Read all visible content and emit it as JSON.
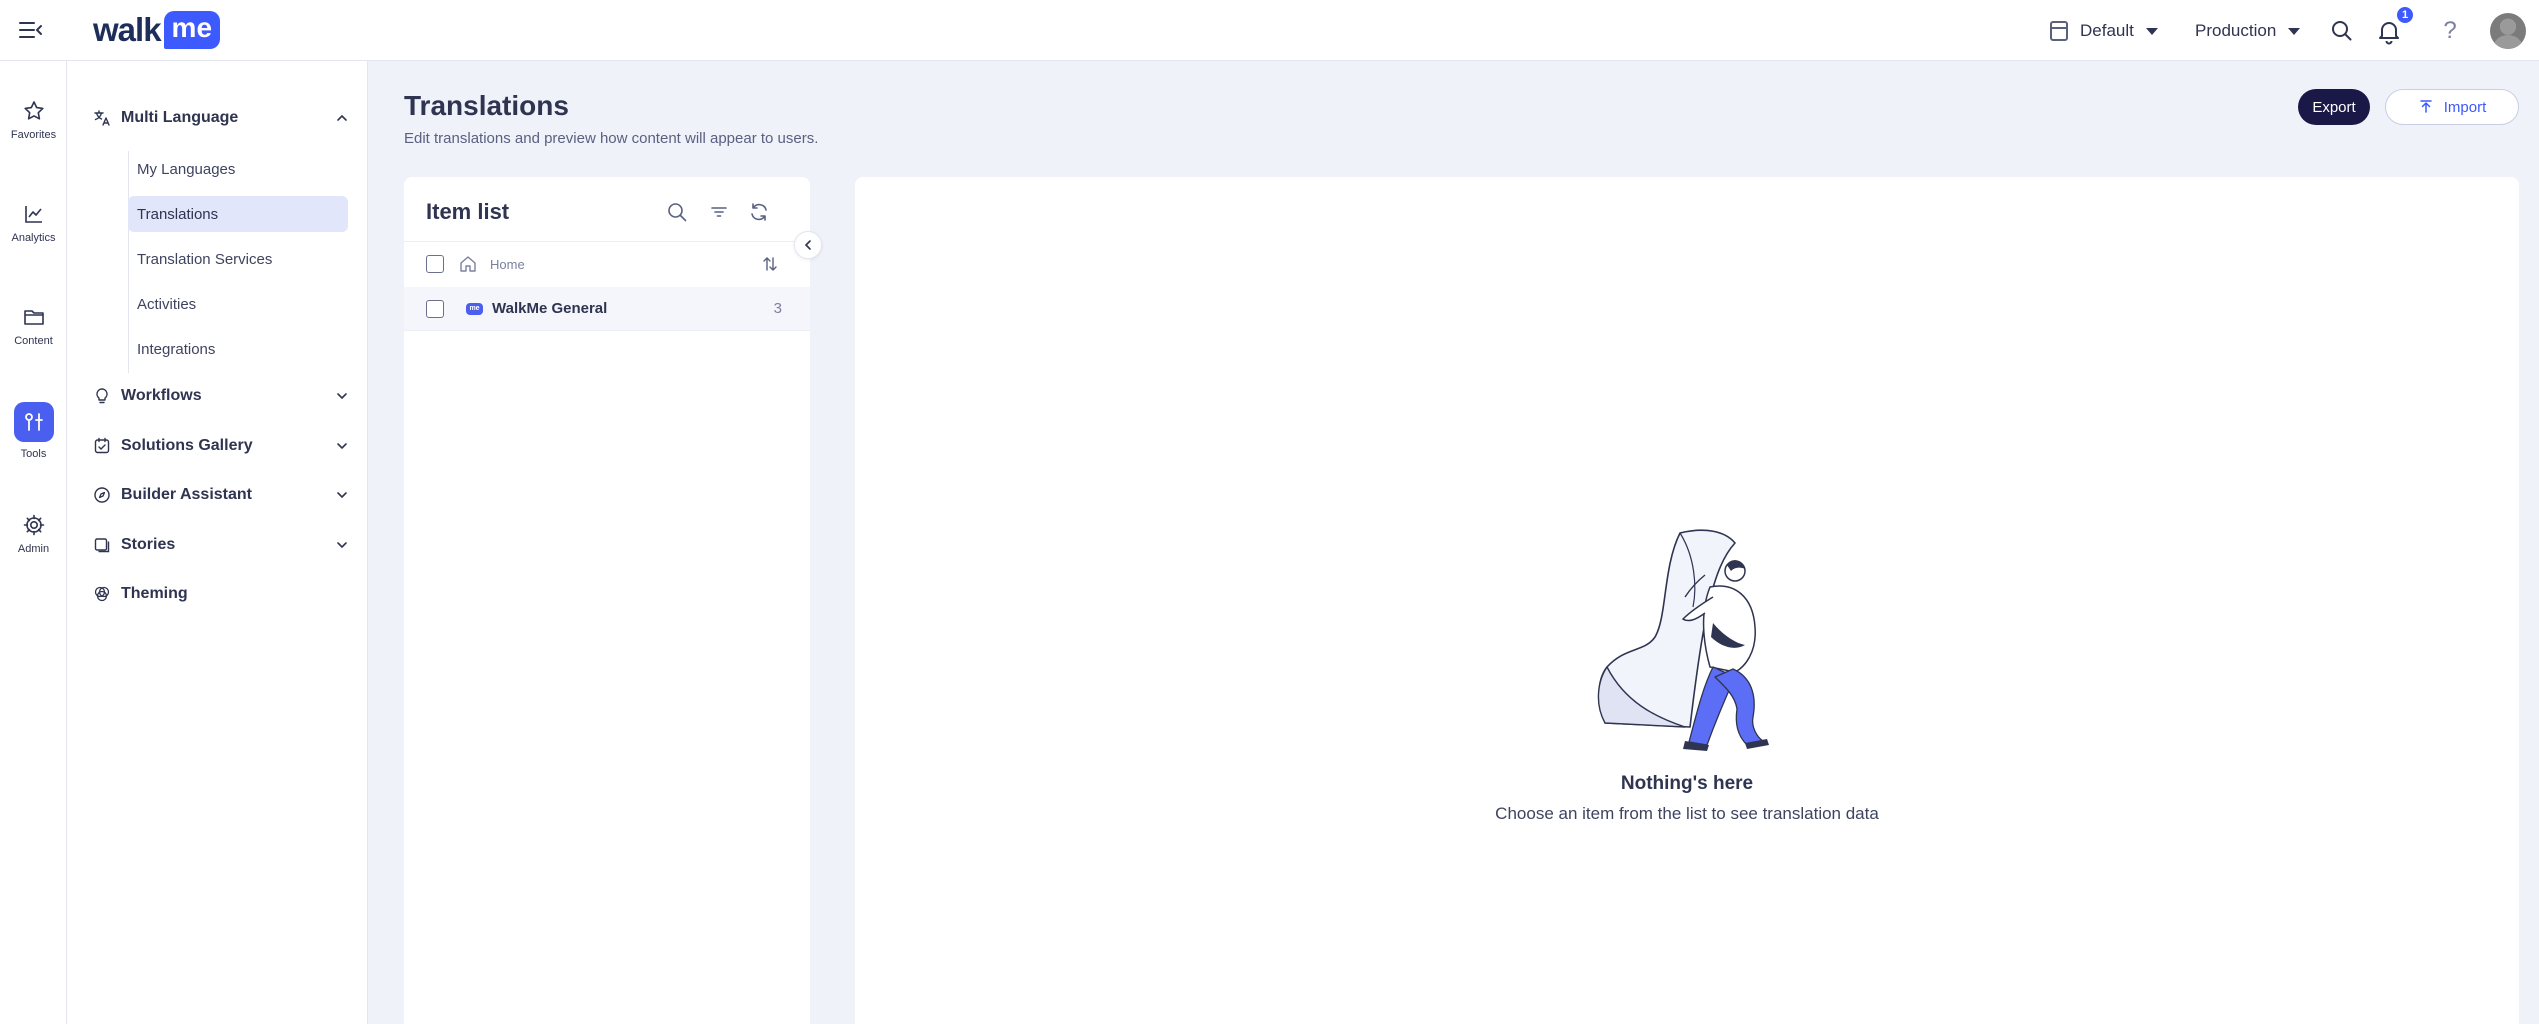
{
  "topbar": {
    "logo_walk": "walk",
    "logo_me": "me",
    "env_default": "Default",
    "env_production": "Production",
    "notifications_count": "1",
    "help_glyph": "?"
  },
  "rail": {
    "items": [
      {
        "label": "Favorites",
        "icon": "star-icon"
      },
      {
        "label": "Analytics",
        "icon": "chart-icon"
      },
      {
        "label": "Content",
        "icon": "folder-icon"
      },
      {
        "label": "Tools",
        "icon": "tools-icon",
        "active": true
      },
      {
        "label": "Admin",
        "icon": "gear-icon"
      }
    ]
  },
  "sidebar": {
    "multi_language": {
      "label": "Multi Language",
      "items": [
        "My Languages",
        "Translations",
        "Translation Services",
        "Activities",
        "Integrations"
      ],
      "active": "Translations"
    },
    "sections": [
      "Workflows",
      "Solutions Gallery",
      "Builder Assistant",
      "Stories",
      "Theming"
    ]
  },
  "page": {
    "title": "Translations",
    "subtitle": "Edit translations and preview how content will appear to users.",
    "export_label": "Export",
    "import_label": "Import"
  },
  "item_list": {
    "title": "Item list",
    "home_label": "Home",
    "items": [
      {
        "chip": "me",
        "label": "WalkMe General",
        "count": "3"
      }
    ]
  },
  "detail": {
    "empty_title": "Nothing's here",
    "empty_subtitle": "Choose an item from the list to see translation data"
  },
  "colors": {
    "accent": "#3d5afe",
    "export_bg": "#1a1847",
    "active_bg": "#e2e6fb",
    "page_bg": "#f0f2fa"
  }
}
